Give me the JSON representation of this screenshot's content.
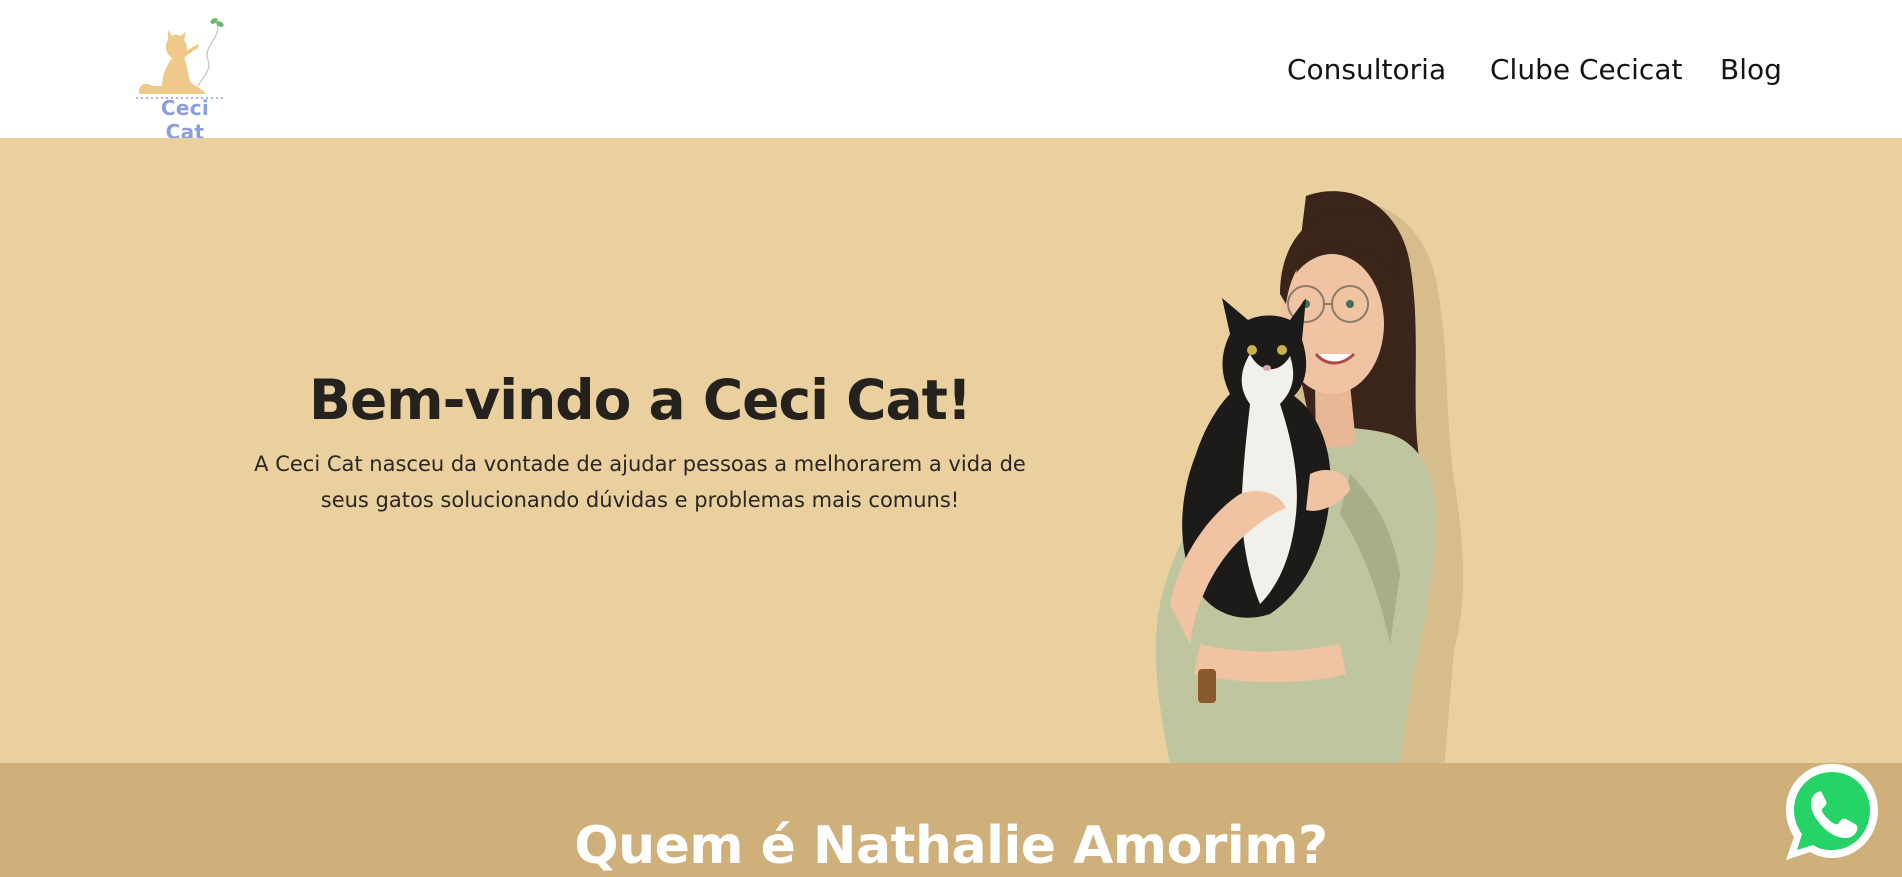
{
  "header": {
    "logo_text": "Ceci Cat",
    "nav": [
      "Consultoria",
      "Clube Cecicat",
      "Blog"
    ]
  },
  "hero": {
    "title": "Bem-vindo a Ceci Cat!",
    "line1": "A Ceci Cat nasceu da vontade de ajudar pessoas a melhorarem a vida de",
    "line2": "seus gatos solucionando dúvidas e problemas mais comuns!"
  },
  "about": {
    "title": "Quem é Nathalie Amorim?"
  },
  "icons": {
    "logo": "cat-logo-icon",
    "whatsapp": "whatsapp-icon"
  },
  "colors": {
    "hero_bg": "#e9d09e",
    "about_bg": "#cfb07a",
    "logo_text": "#8b9ee0",
    "logo_cat": "#f0c98a",
    "whatsapp": "#25d366"
  }
}
